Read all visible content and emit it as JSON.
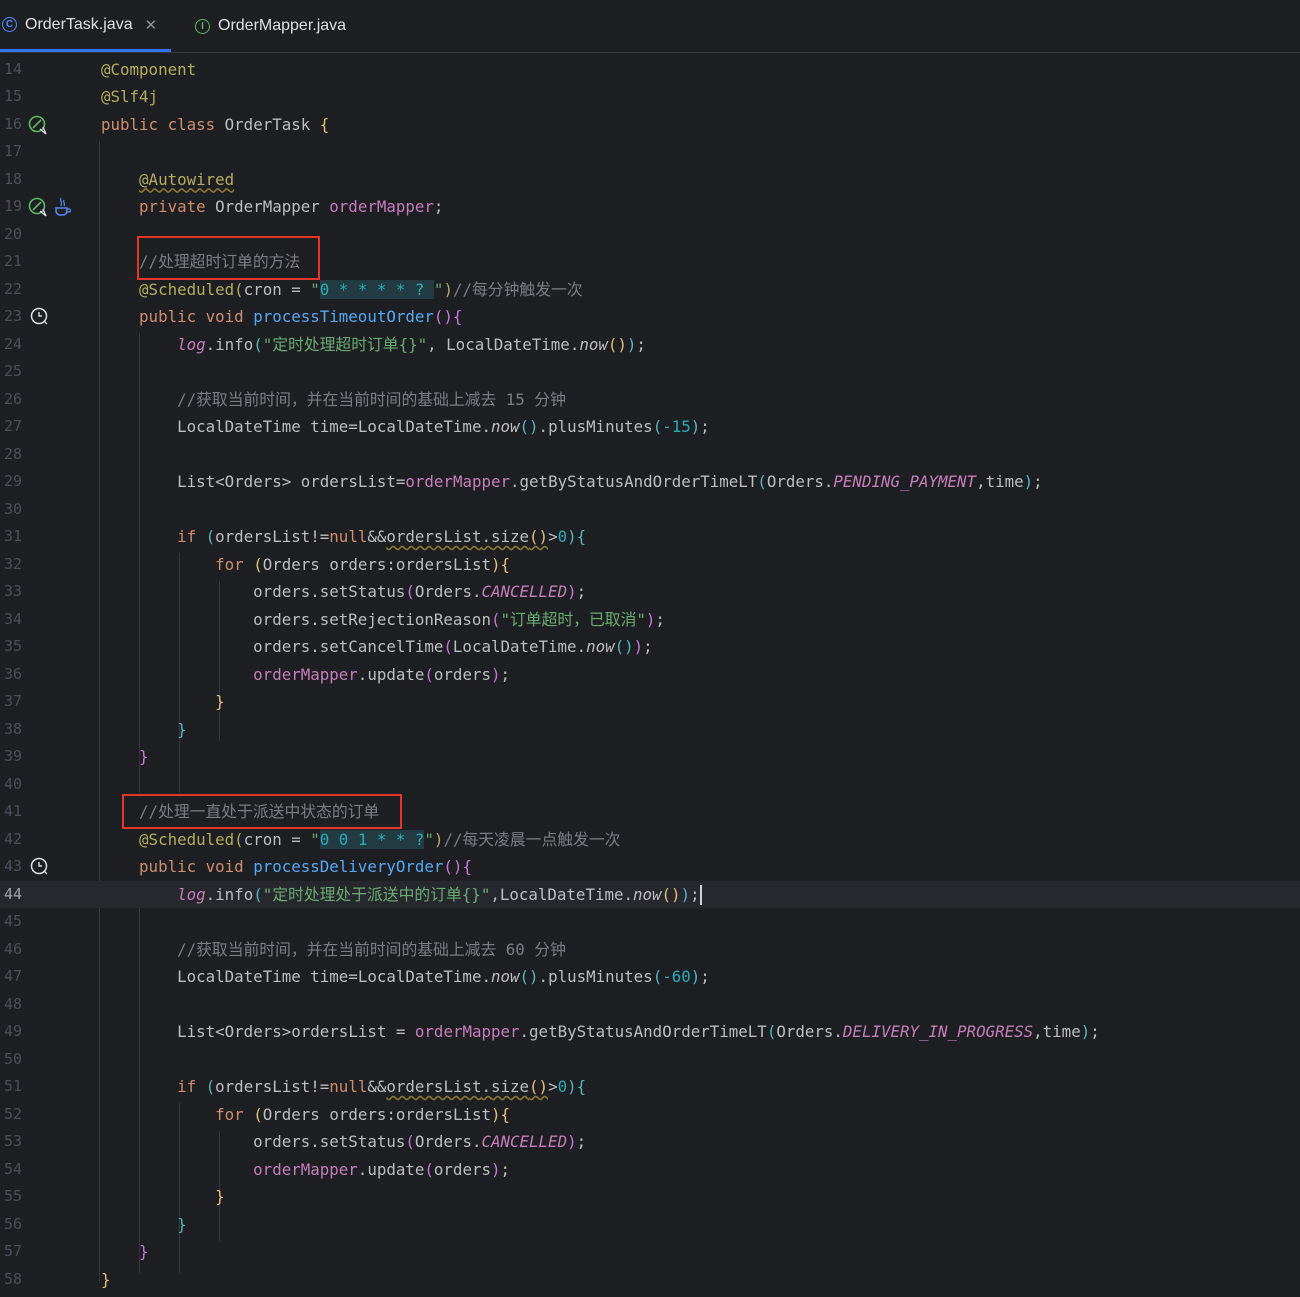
{
  "tabs": [
    {
      "label": "OrderTask.java",
      "icon": "java-class-icon",
      "active": true
    },
    {
      "label": "OrderMapper.java",
      "icon": "java-interface-icon",
      "active": false
    }
  ],
  "line_numbers": [
    "14",
    "15",
    "16",
    "17",
    "18",
    "19",
    "20",
    "21",
    "22",
    "23",
    "24",
    "25",
    "26",
    "27",
    "28",
    "29",
    "30",
    "31",
    "32",
    "33",
    "34",
    "35",
    "36",
    "37",
    "38",
    "39",
    "40",
    "41",
    "42",
    "43",
    "44",
    "45",
    "46",
    "47",
    "48",
    "49",
    "50",
    "51",
    "52",
    "53",
    "54",
    "55",
    "56",
    "57",
    "58"
  ],
  "current_line": "44",
  "code": {
    "ann_component": "@Component",
    "ann_slf4j": "@Slf4j",
    "kw_public_class": "public class",
    "class_name": "OrderTask",
    "ann_autowired": "@Autowired",
    "kw_private": "private",
    "type_order_mapper": "OrderMapper",
    "field_order_mapper": "orderMapper",
    "comment_timeout_method": "//处理超时订单的方法",
    "ann_scheduled": "@Scheduled",
    "param_cron": "cron",
    "cron_timeout": "0 * * * * ?",
    "comment_every_minute": "//每分钟触发一次",
    "kw_public_void": "public void",
    "method_process_timeout": "processTimeoutOrder",
    "log": "log",
    "log_method": "info",
    "log_timeout_msg": "\"定时处理超时订单{}\"",
    "type_local_date_time": "LocalDateTime",
    "now": "now",
    "comment_subtract_15": "//获取当前时间，并在当前时间的基础上减去 15 分钟",
    "var_time": "time",
    "plus_minutes": "plusMinutes",
    "minus_15": "-15",
    "type_list": "List",
    "type_orders": "Orders",
    "var_orders_list": "ordersList",
    "method_get_by_status": "getByStatusAndOrderTimeLT",
    "const_pending_payment": "PENDING_PAYMENT",
    "kw_if": "if",
    "kw_null": "null",
    "method_size": "size",
    "zero": "0",
    "kw_for": "for",
    "var_orders": "orders",
    "method_set_status": "setStatus",
    "const_cancelled": "CANCELLED",
    "method_set_rejection_reason": "setRejectionReason",
    "rejection_reason_msg": "\"订单超时，已取消\"",
    "method_set_cancel_time": "setCancelTime",
    "method_update": "update",
    "comment_delivery_order": "//处理一直处于派送中状态的订单",
    "cron_delivery": "0 0 1 * * ?",
    "comment_daily_1am": "//每天凌晨一点触发一次",
    "method_process_delivery": "processDeliveryOrder",
    "log_delivery_msg": "\"定时处理处于派送中的订单{}\"",
    "comment_subtract_60": "//获取当前时间，并在当前时间的基础上减去 60 分钟",
    "minus_60": "-60",
    "const_delivery_in_progress": "DELIVERY_IN_PROGRESS"
  },
  "colors": {
    "background": "#1e1f22",
    "keyword": "#cf8e6d",
    "annotation": "#b3ae60",
    "string": "#6aab73",
    "comment": "#7a7e85",
    "field": "#c77dbb",
    "method": "#56a8f5",
    "number": "#2aacb8",
    "highlight_box": "#e5362b",
    "tab_accent": "#3574f0"
  }
}
